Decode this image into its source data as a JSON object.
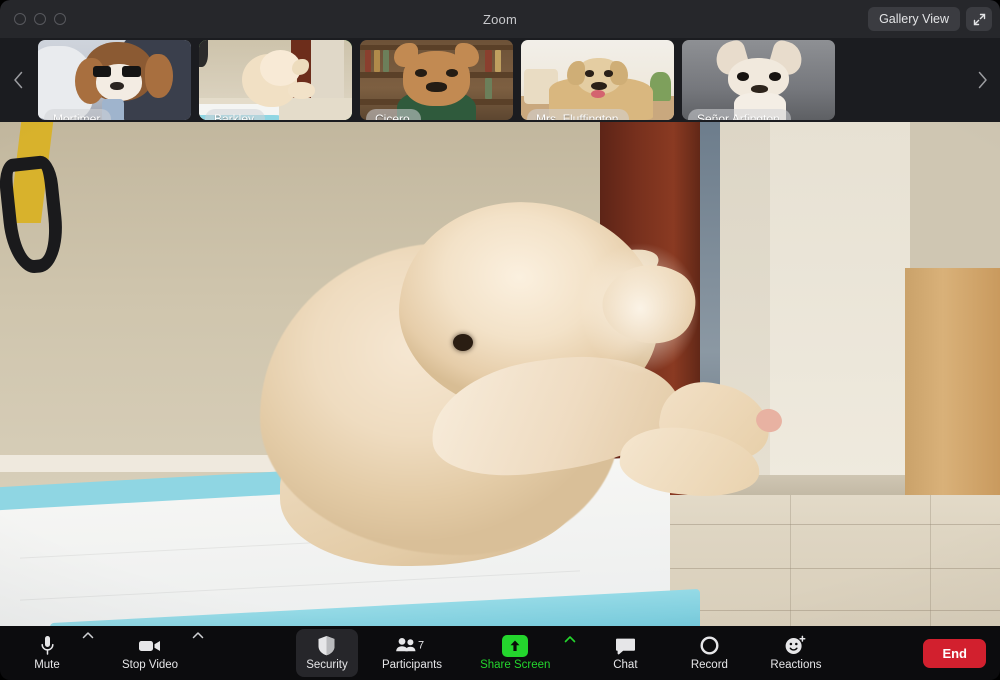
{
  "window": {
    "title": "Zoom",
    "traffic_lights": [
      "close-button",
      "minimize-button",
      "maximize-button"
    ],
    "gallery_view_label": "Gallery View",
    "expand_icon": "expand-diagonal-icon"
  },
  "filmstrip": {
    "prev_icon": "chevron-left-icon",
    "next_icon": "chevron-right-icon",
    "active_border_color": "#25d92b",
    "participants": [
      {
        "name": "Mortimer",
        "active": false,
        "scene": "sc-mortimer"
      },
      {
        "name": "Barkley",
        "active": true,
        "scene": "sc-barkley"
      },
      {
        "name": "Cicero",
        "active": false,
        "scene": "sc-cicero"
      },
      {
        "name": "Mrs. Fluffington",
        "active": false,
        "scene": "sc-fluff"
      },
      {
        "name": "Señor Arfington",
        "active": false,
        "scene": "sc-arf"
      }
    ]
  },
  "stage": {
    "speaker": "Barkley",
    "description": "cream puppy sitting on a white pee pad with blue edges on a tiled floor"
  },
  "toolbar": {
    "mute": {
      "label": "Mute",
      "icon": "microphone-icon",
      "caret": "chevron-up-icon"
    },
    "video": {
      "label": "Stop Video",
      "icon": "camera-icon",
      "caret": "chevron-up-icon"
    },
    "security": {
      "label": "Security",
      "icon": "shield-icon",
      "active": true
    },
    "participants": {
      "label": "Participants",
      "icon": "people-icon",
      "count": "7"
    },
    "share": {
      "label": "Share Screen",
      "icon": "share-up-arrow-icon",
      "caret": "chevron-up-icon",
      "color": "#24d62d"
    },
    "chat": {
      "label": "Chat",
      "icon": "chat-bubble-icon"
    },
    "record": {
      "label": "Record",
      "icon": "record-circle-icon"
    },
    "reactions": {
      "label": "Reactions",
      "icon": "smiley-plus-icon"
    },
    "end": {
      "label": "End",
      "color": "#d2202e"
    }
  }
}
